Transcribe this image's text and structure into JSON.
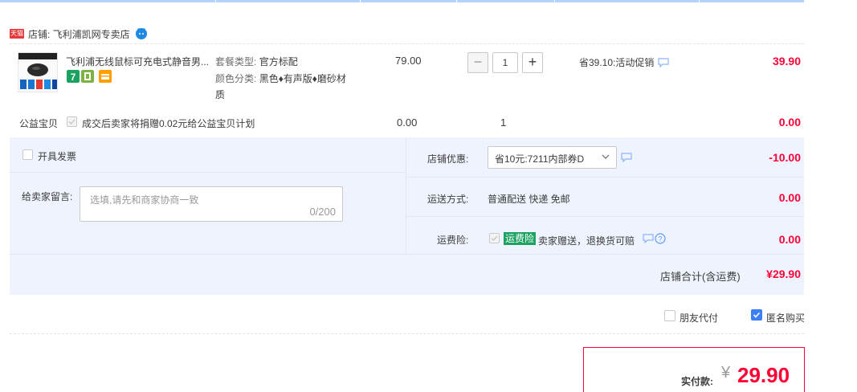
{
  "shop": {
    "badge": "天猫",
    "name": "店铺: 飞利浦凯网专卖店"
  },
  "item": {
    "title": "飞利浦无线鼠标可充电式静音男...",
    "props": [
      {
        "label": "套餐类型:",
        "value": "官方标配"
      },
      {
        "label": "颜色分类:",
        "value": "黑色♦有声版♦磨砂材"
      },
      {
        "label": "",
        "value": "质"
      }
    ],
    "price": "79.00",
    "quantity": "1",
    "minus": "−",
    "plus": "+",
    "promo": "省39.10:活动促销",
    "subtotal": "39.90"
  },
  "charity": {
    "label": "公益宝贝",
    "text": "成交后卖家将捐赠0.02元给公益宝贝计划",
    "price": "0.00",
    "quantity": "1",
    "subtotal": "0.00"
  },
  "invoice": {
    "label": "开具发票"
  },
  "message": {
    "label": "给卖家留言:",
    "placeholder": "选填,请先和商家协商一致",
    "count": "0/200"
  },
  "shop_discount": {
    "label": "店铺优惠:",
    "selected": "省10元:7211内部券D",
    "amount": "-10.00"
  },
  "shipping": {
    "label": "运送方式:",
    "value": "普通配送 快递 免邮",
    "amount": "0.00"
  },
  "insurance": {
    "label": "运费险:",
    "badge": "运费险",
    "text": "卖家赠送，退换货可赔",
    "amount": "0.00"
  },
  "shop_total": {
    "label": "店铺合计(含运费)",
    "amount": "¥29.90"
  },
  "options": {
    "friend_pay": "朋友代付",
    "anonymous": "匿名购买"
  },
  "payment": {
    "label": "实付款:",
    "currency": "¥",
    "amount": "29.90"
  },
  "colors": {
    "accent_red": "#ff0036",
    "panel_bg": "#eef3fd",
    "check_blue": "#3d7ef9",
    "insurance_green": "#1aa260"
  },
  "icons": [
    "tmall-badge-icon",
    "wangwang-chat-icon",
    "chat-bubble-icon",
    "help-icon",
    "chevron-down-icon",
    "checkmark-icon"
  ]
}
